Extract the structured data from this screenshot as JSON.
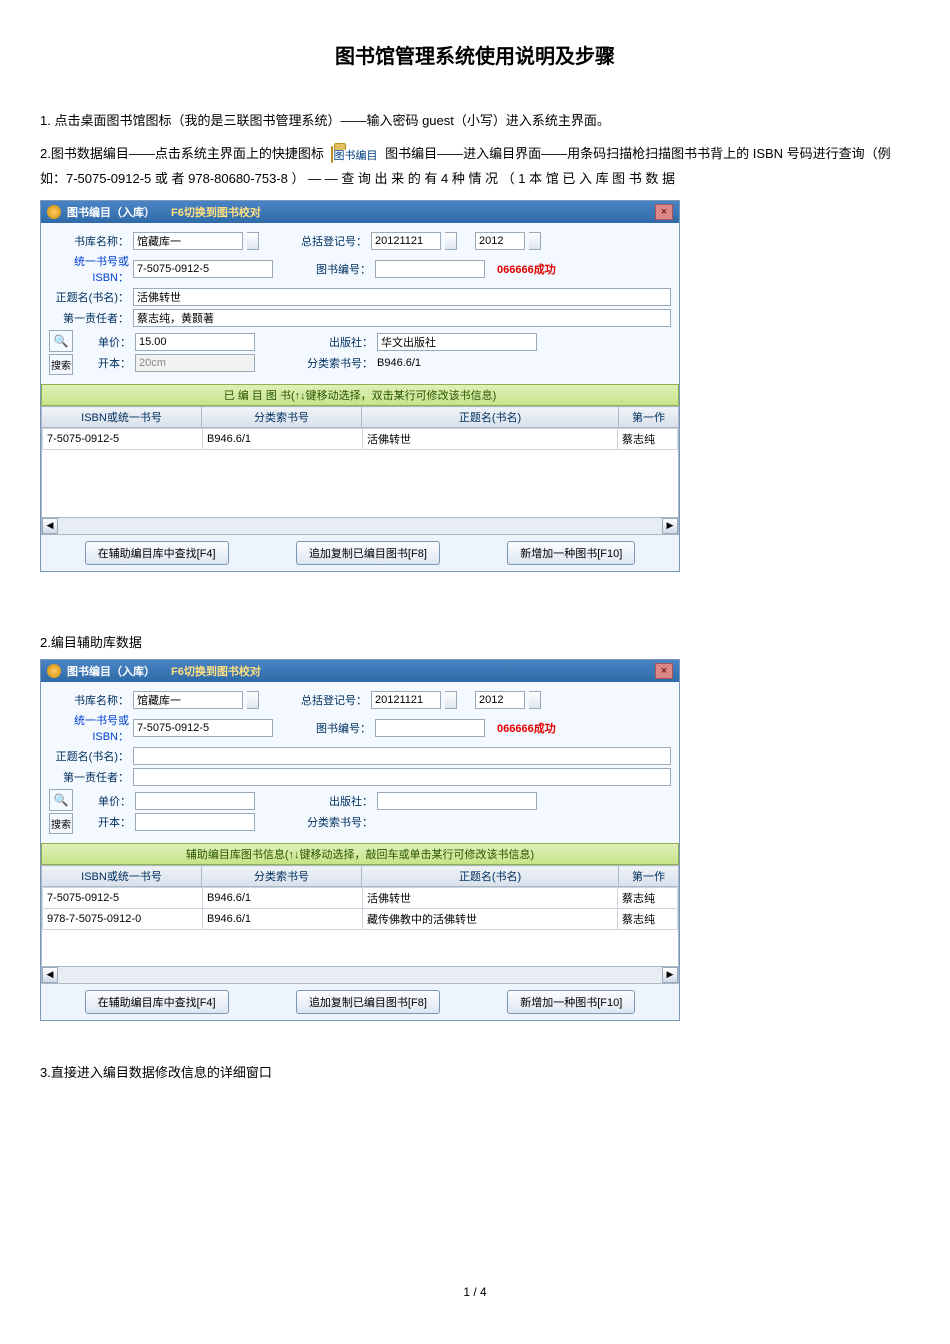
{
  "page": {
    "title": "图书馆管理系统使用说明及步骤",
    "step1": "1.   点击桌面图书馆图标（我的是三联图书管理系统）——输入密码 guest（小写）进入系统主界面。",
    "step2_before_icon": "2.图书数据编目——点击系统主界面上的快捷图标",
    "icon_label": "图书编目",
    "step2_after_icon": "图书编目——进入编目界面——用条码扫描枪扫描图书书背上的 ISBN 号码进行查询（例如：7-5075-0912-5  或  者  978-80680-753-8  ）  —  —  查  询  出  来  的  有  4  种  情  况  （  1  本  馆  已  入  库  图  书  数  据",
    "section2_heading": "2.编目辅助库数据",
    "section3_heading": "3.直接进入编目数据修改信息的详细窗口",
    "page_number": "1 / 4"
  },
  "window1": {
    "title_main": "图书编目（入库）",
    "title_sub": "F6切换到图书校对",
    "close": "×",
    "labels": {
      "lib_name": "书库名称：",
      "isbn": "统一书号或ISBN：",
      "title_name": "正题名(书名)：",
      "author": "第一责任者：",
      "price": "单价：",
      "format": "开本：",
      "reg_no": "总括登记号：",
      "book_no": "图书编号：",
      "publisher": "出版社：",
      "class_no": "分类索书号："
    },
    "values": {
      "lib_name": "馆藏库一",
      "isbn": "7-5075-0912-5",
      "title_name": "活佛转世",
      "author": "蔡志纯，黄颢著",
      "price": "15.00",
      "format": "20cm",
      "reg_no": "20121121",
      "year": "2012",
      "publisher": "华文出版社",
      "class_no": "B946.6/1",
      "success": "066666成功"
    },
    "search_btn": "搜索",
    "grid_header": "已 编 目 图 书(↑↓键移动选择，双击某行可修改该书信息)",
    "columns": {
      "c1": "ISBN或统一书号",
      "c2": "分类索书号",
      "c3": "正题名(书名)",
      "c4": "第一作"
    },
    "rows": [
      {
        "c1": "7-5075-0912-5",
        "c2": "B946.6/1",
        "c3": "活佛转世",
        "c4": "蔡志纯"
      }
    ],
    "buttons": {
      "b1": "在辅助编目库中查找[F4]",
      "b2": "追加复制已编目图书[F8]",
      "b3": "新增加一种图书[F10]"
    }
  },
  "window2": {
    "title_main": "图书编目（入库）",
    "title_sub": "F6切换到图书校对",
    "close": "×",
    "labels": {
      "lib_name": "书库名称：",
      "isbn": "统一书号或ISBN：",
      "title_name": "正题名(书名)：",
      "author": "第一责任者：",
      "price": "单价：",
      "format": "开本：",
      "reg_no": "总括登记号：",
      "book_no": "图书编号：",
      "publisher": "出版社：",
      "class_no": "分类索书号："
    },
    "values": {
      "lib_name": "馆藏库一",
      "isbn": "7-5075-0912-5",
      "reg_no": "20121121",
      "year": "2012",
      "success": "066666成功"
    },
    "search_btn": "搜索",
    "grid_header": "辅助编目库图书信息(↑↓键移动选择，敲回车或单击某行可修改该书信息)",
    "columns": {
      "c1": "ISBN或统一书号",
      "c2": "分类索书号",
      "c3": "正题名(书名)",
      "c4": "第一作"
    },
    "rows": [
      {
        "c1": "7-5075-0912-5",
        "c2": "B946.6/1",
        "c3": "活佛转世",
        "c4": "蔡志纯"
      },
      {
        "c1": "978-7-5075-0912-0",
        "c2": "B946.6/1",
        "c3": "藏传佛教中的活佛转世",
        "c4": "蔡志纯"
      }
    ],
    "buttons": {
      "b1": "在辅助编目库中查找[F4]",
      "b2": "追加复制已编目图书[F8]",
      "b3": "新增加一种图书[F10]"
    }
  }
}
